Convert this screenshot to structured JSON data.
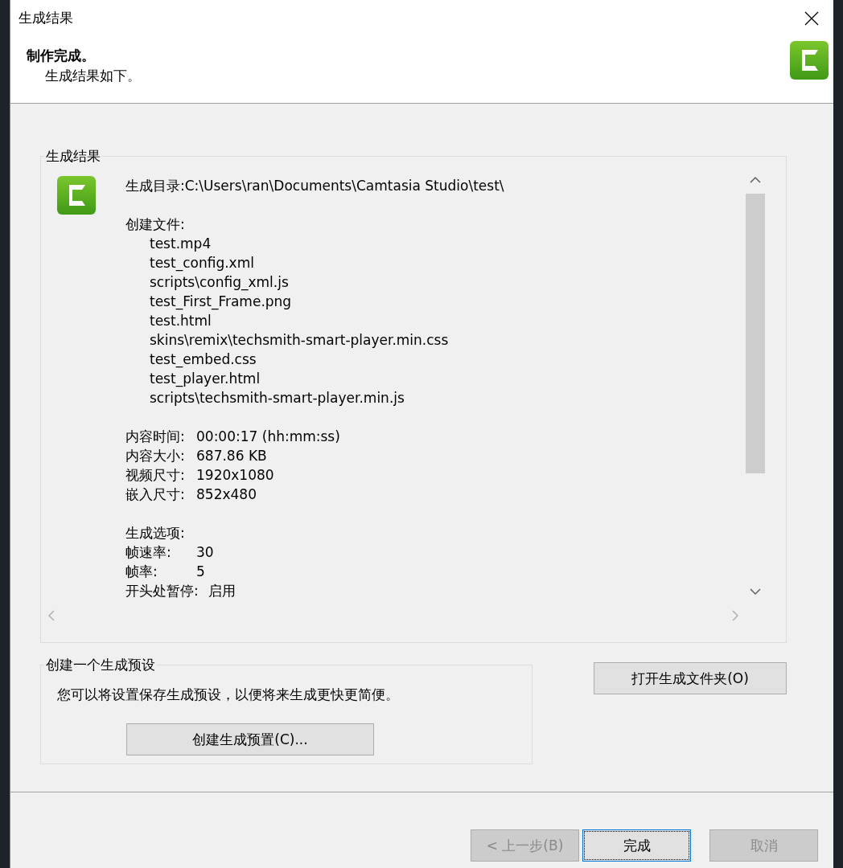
{
  "window": {
    "title": "生成结果"
  },
  "header": {
    "title": "制作完成。",
    "subtitle": "生成结果如下。"
  },
  "results_group": {
    "legend": "生成结果",
    "directory": "生成目录:C:\\Users\\ran\\Documents\\Camtasia Studio\\test\\",
    "files_heading": "创建文件:",
    "files": [
      "test.mp4",
      "test_config.xml",
      "scripts\\config_xml.js",
      "test_First_Frame.png",
      "test.html",
      "skins\\remix\\techsmith-smart-player.min.css",
      "test_embed.css",
      "test_player.html",
      "scripts\\techsmith-smart-player.min.js"
    ],
    "info": [
      {
        "label": "内容时间:",
        "value": "00:00:17 (hh:mm:ss)"
      },
      {
        "label": "内容大小:",
        "value": "687.86 KB"
      },
      {
        "label": "视频尺寸:",
        "value": "1920x1080"
      },
      {
        "label": "嵌入尺寸:",
        "value": "852x480"
      }
    ],
    "options_heading": "生成选项:",
    "options": [
      {
        "label": "帧速率:",
        "value": "30"
      },
      {
        "label": "帧率:",
        "value": "5"
      },
      {
        "label": "开头处暂停:",
        "value": "启用"
      }
    ]
  },
  "preset_group": {
    "legend": "创建一个生成预设",
    "description": "您可以将设置保存生成预设，以便将来生成更快更简便。",
    "button": "创建生成预置(C)..."
  },
  "open_folder_button": "打开生成文件夹(O)",
  "footer_buttons": [
    {
      "label": "< 上一步(B)",
      "disabled": true,
      "focused": false
    },
    {
      "label": "完成",
      "disabled": false,
      "focused": true
    },
    {
      "label": "取消",
      "disabled": true,
      "focused": false
    }
  ]
}
